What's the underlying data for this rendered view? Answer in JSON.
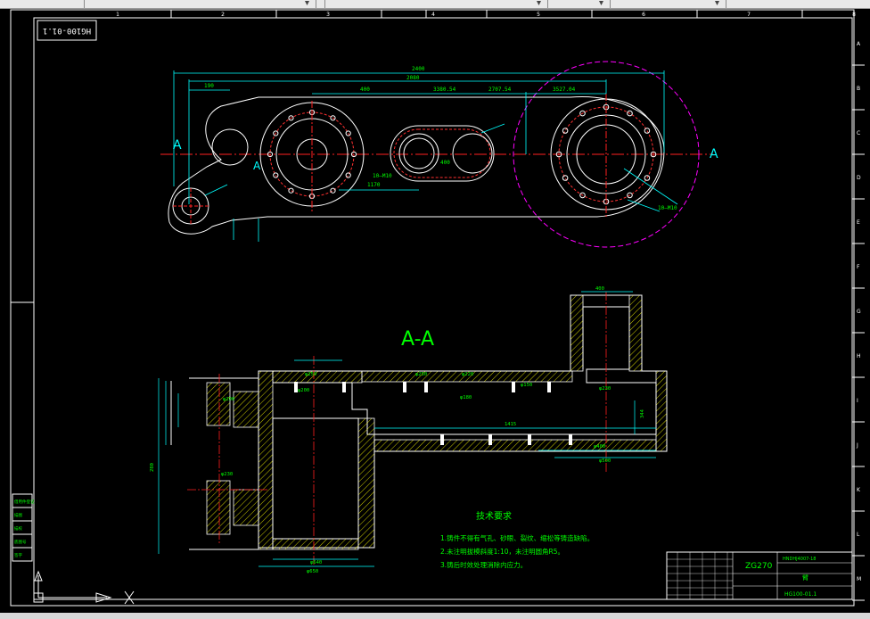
{
  "sheet": {
    "top_ruler": [
      "1",
      "2",
      "3",
      "4",
      "5",
      "6",
      "7",
      "8"
    ],
    "side_ruler": [
      "A",
      "B",
      "C",
      "D",
      "E",
      "F",
      "G",
      "H",
      "I",
      "J",
      "K",
      "L",
      "M"
    ],
    "stamp_top_left": "HG100-01.1"
  },
  "plan_view": {
    "section_mark_left": "A",
    "section_mark_right": "A",
    "section_mark_inner": "A",
    "dim_overall": "2400",
    "dim_second": "2080",
    "dim_190": "190",
    "dim_400": "400",
    "dim_mid1": "3380.54",
    "dim_mid2": "2707.54",
    "dim_mid3": "3527.04",
    "dim_1170": "1170",
    "dim_hole_left": "10—M10",
    "dim_hole_right": "10—M10",
    "dim_slot": "400"
  },
  "section_view": {
    "title": "A-A",
    "dims": [
      "φ250",
      "φ200",
      "φ230",
      "φ250",
      "φ180",
      "φ220",
      "φ150",
      "φ640",
      "φ400",
      "φ500",
      "φ650",
      "1415",
      "280",
      "400",
      "φ230",
      "344",
      "φ200"
    ]
  },
  "tech_notes": {
    "title": "技术要求",
    "lines": [
      "1.铸件不得有气孔、砂眼、裂纹、缩松等铸造缺陷。",
      "2.未注明拔模斜度1:10，未注明圆角R5。",
      "3.铸后时效处理消除内应力。"
    ]
  },
  "title_block": {
    "material": "ZG270",
    "top_right": "HNDHJ4007-18",
    "part_name": "臂",
    "drawing_no": "HG100-01.1"
  },
  "left_table": {
    "rows": [
      "借用件登记",
      "描图",
      "描校",
      "底图号",
      "签字"
    ]
  },
  "colors": {
    "frame": "#ffffff",
    "outline": "#ffffff",
    "dimension": "#00ffff",
    "text": "#00ff00",
    "center": "#ff2020",
    "hatch": "#ffff00",
    "bolt_circle": "#ff3030",
    "phantom": "#ff00ff"
  }
}
